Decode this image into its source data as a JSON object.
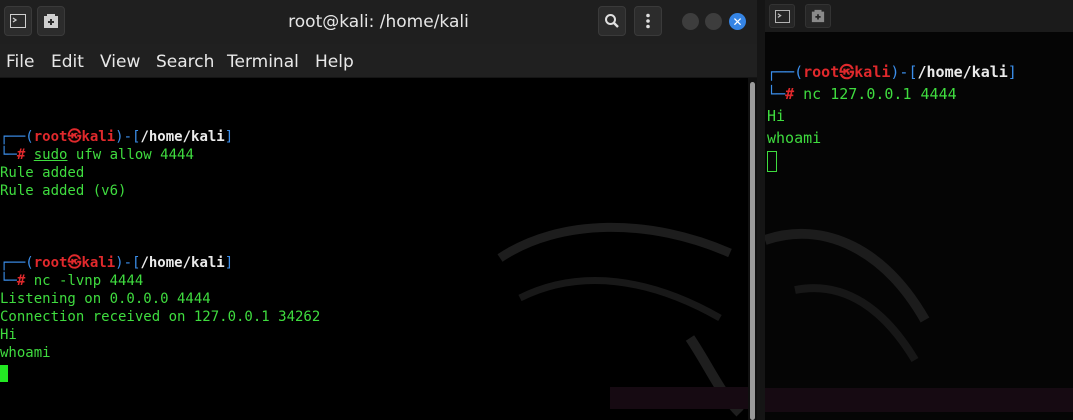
{
  "left_window": {
    "title": "root@kali: /home/kali",
    "menu": [
      "File",
      "Edit",
      "View",
      "Search",
      "Terminal",
      "Help"
    ],
    "terminal": {
      "prompt1": {
        "user": "root",
        "skull": "㉿",
        "host": "kali",
        "path": "/home/kali",
        "command_sudo": "sudo",
        "command_rest": " ufw allow 4444"
      },
      "output1": [
        "Rule added",
        "Rule added (v6)"
      ],
      "prompt2": {
        "user": "root",
        "skull": "㉿",
        "host": "kali",
        "path": "/home/kali",
        "command": "nc -lvnp 4444"
      },
      "output2": [
        "Listening on 0.0.0.0 4444",
        "Connection received on 127.0.0.1 34262",
        "Hi",
        "whoami"
      ]
    }
  },
  "right_window": {
    "terminal": {
      "prompt": {
        "user": "root",
        "skull": "㉿",
        "host": "kali",
        "path": "/home/kali",
        "command": "nc 127.0.0.1 4444"
      },
      "output": [
        "Hi",
        "whoami"
      ]
    }
  },
  "colors": {
    "prompt_blue": "#3b8eea",
    "user_red": "#e0292c",
    "text_green": "#3fdc3f",
    "close_button_blue": "#3584e4"
  },
  "icons": {
    "new_tab": "new-tab-icon",
    "terminal": "terminal-icon",
    "search": "search-icon",
    "menu": "kebab-menu-icon",
    "minimize": "minimize-icon",
    "maximize": "maximize-icon",
    "close": "close-icon"
  }
}
